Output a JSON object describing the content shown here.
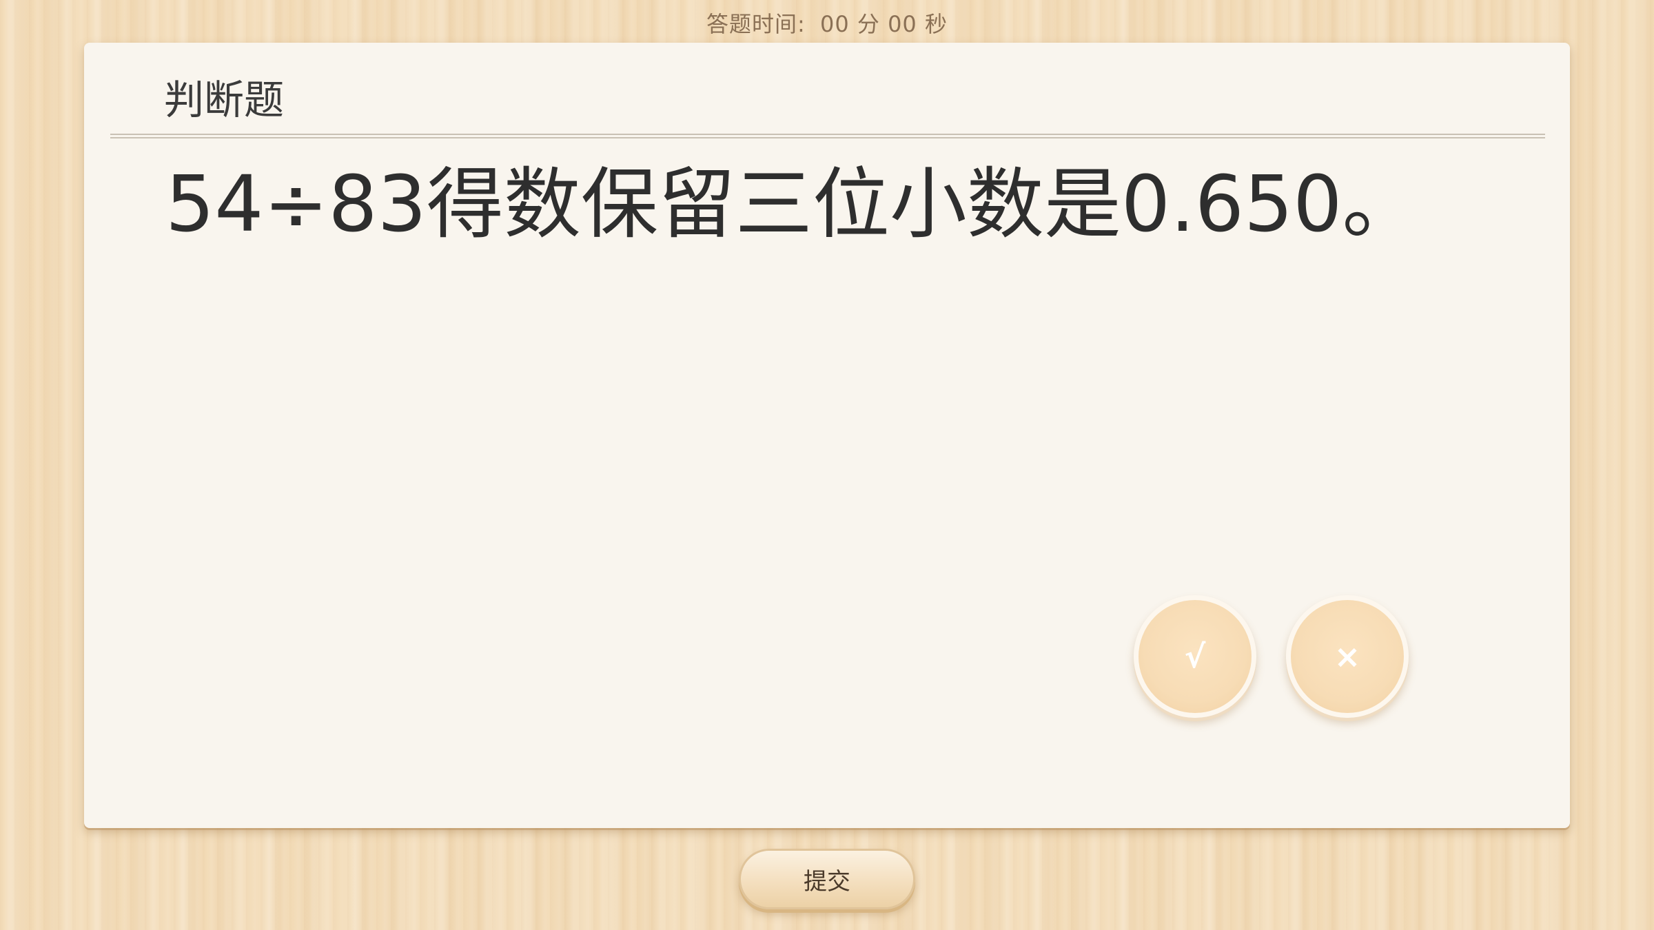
{
  "timer": {
    "label": "答题时间:",
    "minutes": "00",
    "minutes_unit": "分",
    "seconds": "00",
    "seconds_unit": "秒"
  },
  "card": {
    "title": "判断题",
    "question": "54÷83得数保留三位小数是0.650。"
  },
  "answers": {
    "true_label": "√",
    "false_label": "×"
  },
  "submit": {
    "label": "提交"
  },
  "colors": {
    "background": "#f3dcb8",
    "card": "#f9f5ee",
    "answer_button": "#f7dcb5",
    "text": "#2e2e2e"
  }
}
